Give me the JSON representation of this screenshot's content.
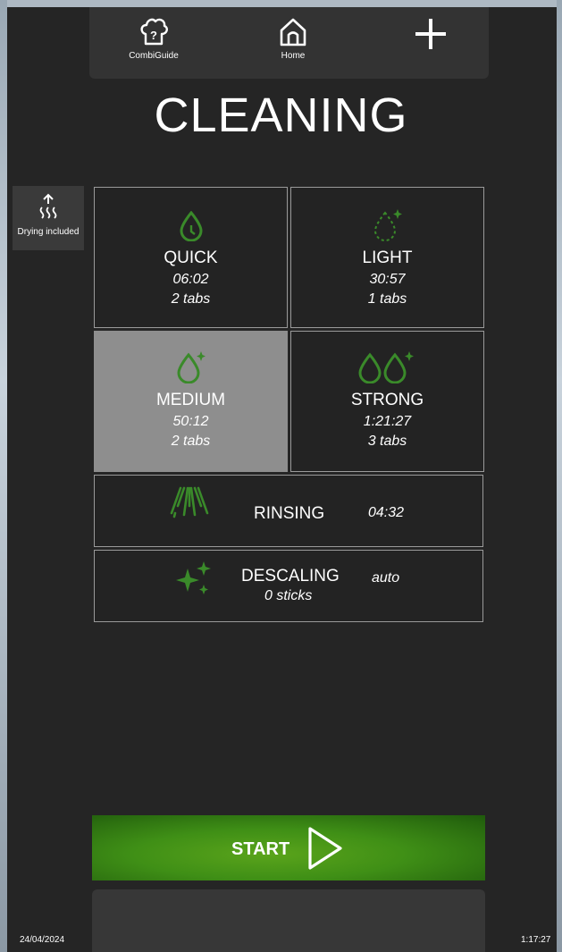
{
  "topbar": {
    "combiguide_label": "CombiGuide",
    "home_label": "Home"
  },
  "page_title": "CLEANING",
  "drying": {
    "label": "Drying included"
  },
  "programs": [
    {
      "name": "QUICK",
      "time": "06:02",
      "tabs": "2 tabs",
      "icon": "timer-drop-icon"
    },
    {
      "name": "LIGHT",
      "time": "30:57",
      "tabs": "1 tabs",
      "icon": "dashed-drop-sparkle-icon"
    },
    {
      "name": "MEDIUM",
      "time": "50:12",
      "tabs": "2 tabs",
      "icon": "drop-sparkle-icon",
      "selected": true
    },
    {
      "name": "STRONG",
      "time": "1:21:27",
      "tabs": "3 tabs",
      "icon": "double-drop-sparkle-icon"
    }
  ],
  "rinsing": {
    "name": "RINSING",
    "time": "04:32",
    "icon": "spray-icon"
  },
  "descaling": {
    "name": "DESCALING",
    "sticks": "0 sticks",
    "mode": "auto",
    "icon": "sparkles-icon"
  },
  "start": {
    "label": "START",
    "icon": "play-outline-icon"
  },
  "status": {
    "date": "24/04/2024",
    "time": "1:17:27"
  },
  "colors": {
    "accent_green": "#3a8a2a",
    "selected_tile": "#8e8e8e",
    "background": "#252525"
  }
}
